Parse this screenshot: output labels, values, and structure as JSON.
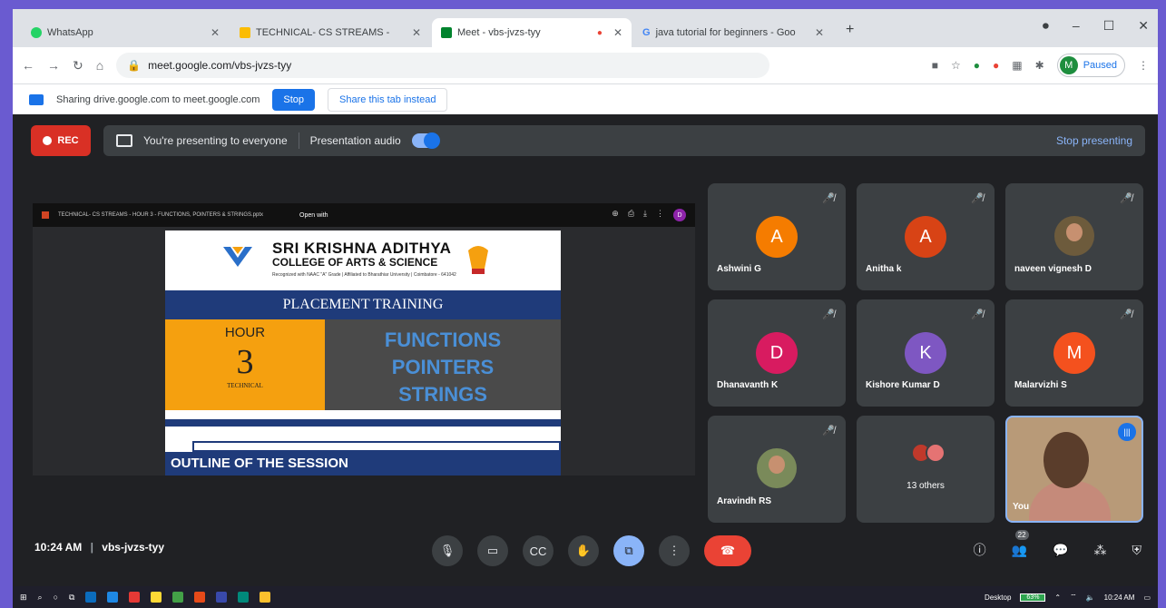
{
  "browser": {
    "tabs": [
      {
        "title": "WhatsApp",
        "color": "#25d366"
      },
      {
        "title": "TECHNICAL- CS STREAMS -",
        "color": "#fbbc04"
      },
      {
        "title": "Meet - vbs-jvzs-tyy",
        "color": "#00832d"
      },
      {
        "title": "java tutorial for beginners - Goo",
        "color": "#4285f4"
      }
    ],
    "new_tab_label": "+",
    "url": "meet.google.com/vbs-jvzs-tyy",
    "profile_initial": "M",
    "profile_status": "Paused"
  },
  "sharing_bar": {
    "message": "Sharing drive.google.com to meet.google.com",
    "stop_label": "Stop",
    "share_tab_label": "Share this tab instead"
  },
  "meet": {
    "rec_label": "REC",
    "presenting_text": "You're presenting to everyone",
    "presentation_audio_label": "Presentation audio",
    "stop_presenting_label": "Stop presenting",
    "time": "10:24 AM",
    "meeting_code": "vbs-jvzs-tyy",
    "people_count": "22"
  },
  "viewer": {
    "file_title": "TECHNICAL- CS STREAMS - HOUR 3 - FUNCTIONS, POINTERS & STRINGS.pptx",
    "open_with": "Open with",
    "avatar": "D"
  },
  "slide": {
    "college_line1": "SRI KRISHNA ADITHYA",
    "college_line2": "COLLEGE OF ARTS & SCIENCE",
    "college_line3": "Recognized with NAAC \"A\" Grade | Affiliated to Bharathiar University | Coimbatore - 641042",
    "banner": "PLACEMENT TRAINING",
    "hour_label": "HOUR",
    "hour_number": "3",
    "hour_sub": "TECHNICAL",
    "topics": [
      "FUNCTIONS",
      "POINTERS",
      "STRINGS"
    ],
    "outline": "OUTLINE OF THE SESSION"
  },
  "participants": [
    {
      "name": "Ashwini G",
      "initial": "A",
      "color": "#f57c00"
    },
    {
      "name": "Anitha k",
      "initial": "A",
      "color": "#d84315"
    },
    {
      "name": "naveen vignesh D",
      "initial": "",
      "color": ""
    },
    {
      "name": "Dhanavanth K",
      "initial": "D",
      "color": "#d81b60"
    },
    {
      "name": "Kishore Kumar D",
      "initial": "K",
      "color": "#7e57c2"
    },
    {
      "name": "Malarvizhi S",
      "initial": "M",
      "color": "#f4511e"
    },
    {
      "name": "Aravindh RS",
      "initial": "",
      "color": ""
    }
  ],
  "others_label": "13 others",
  "you_label": "You",
  "taskbar": {
    "desktop_label": "Desktop",
    "battery": "63%",
    "clock": "10:24 AM"
  }
}
